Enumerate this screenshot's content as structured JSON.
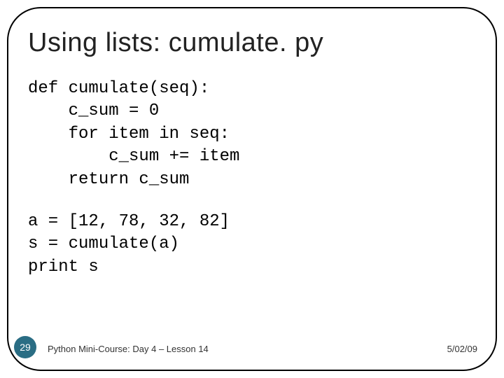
{
  "title": "Using lists: cumulate. py",
  "code1": "def cumulate(seq):\n    c_sum = 0\n    for item in seq:\n        c_sum += item\n    return c_sum",
  "code2": "a = [12, 78, 32, 82]\ns = cumulate(a)\nprint s",
  "page_number": "29",
  "footer_text": "Python Mini-Course: Day 4 – Lesson 14",
  "footer_date": "5/02/09"
}
